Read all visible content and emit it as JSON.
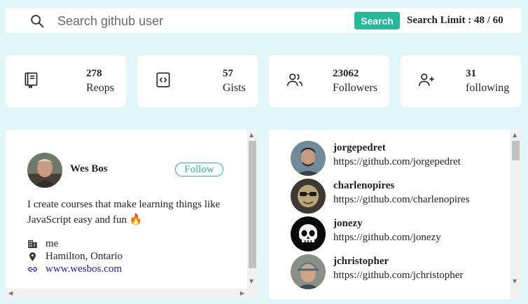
{
  "search": {
    "placeholder": "Search github user",
    "button_label": "Search",
    "limit_text": "Search Limit : 48 / 60"
  },
  "stats": [
    {
      "icon": "book-icon",
      "value": "278",
      "label": "Reops"
    },
    {
      "icon": "code-icon",
      "value": "57",
      "label": "Gists"
    },
    {
      "icon": "users-icon",
      "value": "23062",
      "label": "Followers"
    },
    {
      "icon": "user-plus-icon",
      "value": "31",
      "label": "following"
    }
  ],
  "user": {
    "name": "Wes Bos",
    "follow_label": "Follow",
    "bio": "I create courses that make learning things like JavaScript easy and fun",
    "bio_emoji": "🔥",
    "company": "me",
    "location": "Hamilton, Ontario",
    "blog": "www.wesbos.com"
  },
  "followers": [
    {
      "login": "jorgepedret",
      "url": "https://github.com/jorgepedret"
    },
    {
      "login": "charlenopires",
      "url": "https://github.com/charlenopires"
    },
    {
      "login": "jonezy",
      "url": "https://github.com/jonezy"
    },
    {
      "login": "jchristopher",
      "url": "https://github.com/jchristopher"
    }
  ],
  "colors": {
    "accent": "#25b99a",
    "page_bg": "#e1f6f9",
    "link": "#1a1aa8"
  }
}
